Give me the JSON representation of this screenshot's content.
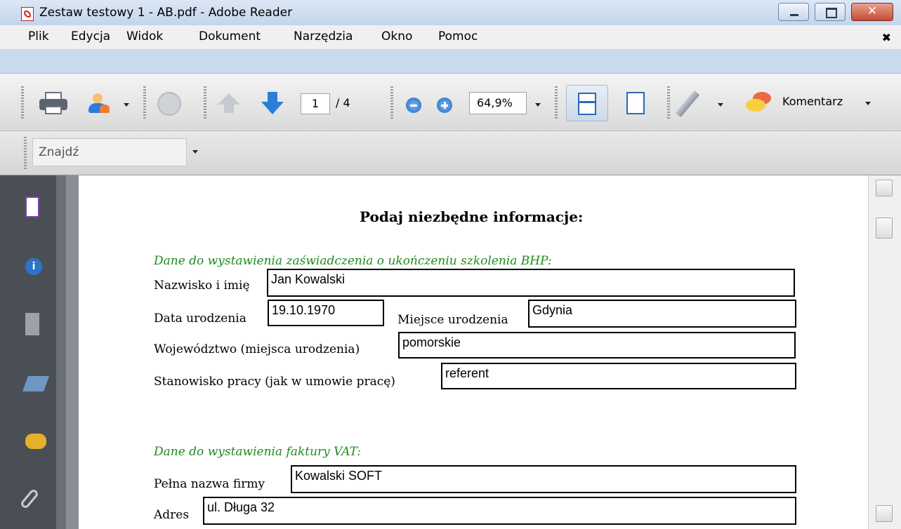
{
  "window": {
    "title": "Zestaw testowy 1 - AB.pdf - Adobe Reader"
  },
  "menu": {
    "items": [
      "Plik",
      "Edycja",
      "Widok",
      "Dokument",
      "Narzędzia",
      "Okno",
      "Pomoc"
    ],
    "close": "✖"
  },
  "toolbar": {
    "current_page": "1",
    "total_pages": "/ 4",
    "zoom": "64,9%",
    "comment_label": "Komentarz"
  },
  "find": {
    "placeholder": "Znajdź"
  },
  "document": {
    "title": "Podaj niezbędne informacje:",
    "section1": "Dane do wystawienia zaświadczenia o ukończeniu szkolenia BHP:",
    "name_label": "Nazwisko i imię",
    "name_value": "Jan Kowalski",
    "birthdate_label": "Data urodzenia",
    "birthdate_value": "19.10.1970",
    "birthplace_label": "Miejsce urodzenia",
    "birthplace_value": "Gdynia",
    "voivodeship_label": "Województwo (miejsca urodzenia)",
    "voivodeship_value": "pomorskie",
    "position_label": "Stanowisko pracy (jak w umowie pracę)",
    "position_value": "referent",
    "section2": "Dane do wystawienia faktury VAT:",
    "company_label": "Pełna nazwa firmy",
    "company_value": "Kowalski SOFT",
    "address_label": "Adres",
    "address_value": "ul. Długa 32"
  },
  "icons": [
    "pdf-file-icon",
    "print-icon",
    "share-icon",
    "globe-icon",
    "prev-page-icon",
    "next-page-icon",
    "zoom-out-icon",
    "zoom-in-icon",
    "fit-width-icon",
    "fit-page-icon",
    "pen-icon",
    "comment-icon",
    "pages-icon",
    "info-icon",
    "layers-icon",
    "signature-icon",
    "comments-icon",
    "attachment-icon"
  ]
}
